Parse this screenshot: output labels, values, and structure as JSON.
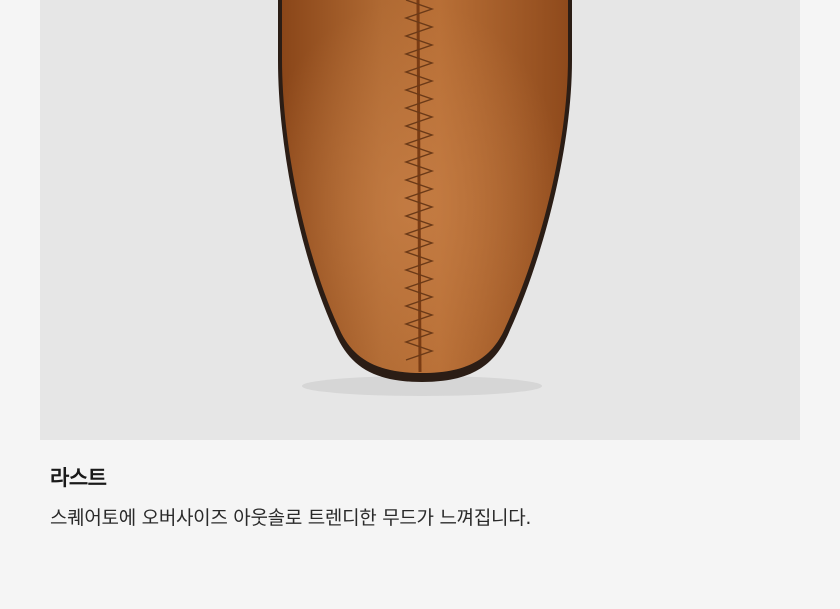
{
  "product_detail": {
    "image": {
      "subject": "shoe-toe-closeup",
      "colors": {
        "background": "#e6e6e6",
        "leather": "#a45a26",
        "leather_highlight": "#c37a44",
        "sole": "#2b1d15",
        "stitch": "#6b3a18"
      }
    },
    "feature_title": "라스트",
    "feature_description": "스퀘어토에 오버사이즈 아웃솔로 트렌디한 무드가 느껴집니다."
  }
}
